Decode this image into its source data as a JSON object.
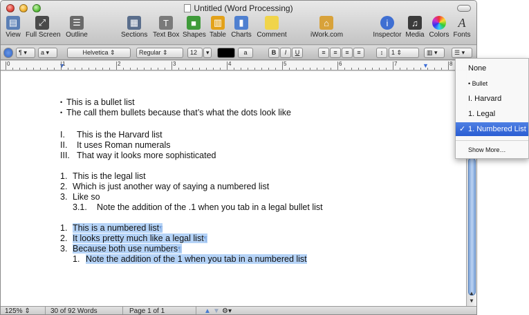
{
  "window": {
    "title": "Untitled (Word Processing)"
  },
  "toolbar": {
    "items": [
      {
        "label": "View",
        "icon": "view-icon",
        "color": "#5b7fb5"
      },
      {
        "label": "Full Screen",
        "icon": "full-screen-icon",
        "color": "#4a4a4a"
      },
      {
        "label": "Outline",
        "icon": "outline-icon",
        "color": "#6a6a6a"
      },
      {
        "label": "Sections",
        "icon": "sections-icon",
        "color": "#5a6e8c"
      },
      {
        "label": "Text Box",
        "icon": "text-box-icon",
        "color": "#7a7a7a"
      },
      {
        "label": "Shapes",
        "icon": "shapes-icon",
        "color": "#3f9b3a"
      },
      {
        "label": "Table",
        "icon": "table-icon",
        "color": "#e3a21a"
      },
      {
        "label": "Charts",
        "icon": "charts-icon",
        "color": "#4f80d0"
      },
      {
        "label": "Comment",
        "icon": "comment-icon",
        "color": "#f0d44a"
      },
      {
        "label": "iWork.com",
        "icon": "iwork-icon",
        "color": "#d8a23a"
      },
      {
        "label": "Inspector",
        "icon": "inspector-icon",
        "color": "#3f6fd2"
      },
      {
        "label": "Media",
        "icon": "media-icon",
        "color": "#3b3b3b"
      },
      {
        "label": "Colors",
        "icon": "colors-icon",
        "color": "#cc4a9a"
      },
      {
        "label": "Fonts",
        "icon": "fonts-icon",
        "color": "#333333"
      }
    ]
  },
  "formatbar": {
    "style_menu": "¶",
    "char_menu": "a",
    "font_family": "Helvetica",
    "font_style": "Regular",
    "font_size": "12",
    "text_color": "#000000",
    "highlight": "a",
    "bold": "B",
    "italic": "I",
    "underline": "U",
    "line_spacing": "1"
  },
  "ruler": {
    "numbers": [
      "0",
      "1",
      "2",
      "3",
      "4",
      "5",
      "6",
      "7",
      "8"
    ]
  },
  "document": {
    "bullets": [
      "This is a bullet list",
      "The call them bullets because that’s what the dots look like"
    ],
    "harvard": [
      {
        "marker": "I.",
        "text": "This is the Harvard list"
      },
      {
        "marker": "II.",
        "text": "It uses Roman numerals"
      },
      {
        "marker": "III.",
        "text": "That way it looks more sophisticated"
      }
    ],
    "legal": [
      {
        "marker": "1.",
        "text": "This is the legal list"
      },
      {
        "marker": "2.",
        "text": "Which is just another way of saying a numbered list"
      },
      {
        "marker": "3.",
        "text": "Like so"
      },
      {
        "marker": "3.1.",
        "text": "Note the addition of the .1 when you tab in a legal bullet list"
      }
    ],
    "numbered": [
      {
        "marker": "1.",
        "text": "This is a numbered list"
      },
      {
        "marker": "2.",
        "text": "It looks pretty much like a legal list"
      },
      {
        "marker": "3.",
        "text": "Because both use numbers"
      },
      {
        "marker": "1.",
        "text": "Note the addition of the 1 when you tab in a numbered list"
      }
    ],
    "pilcrow": "¶",
    "bullet_char": "•"
  },
  "statusbar": {
    "zoom": "125%",
    "word_count": "30 of 92 Words",
    "page": "Page 1 of 1"
  },
  "list_menu": {
    "items": [
      "None",
      "• Bullet",
      "I. Harvard",
      "1. Legal",
      "1. Numbered List"
    ],
    "selected": "1. Numbered List",
    "check": "✓",
    "more": "Show More…"
  },
  "colors": {
    "selection": "#b5d3f7",
    "menu_highlight": "#2a5dd3"
  }
}
